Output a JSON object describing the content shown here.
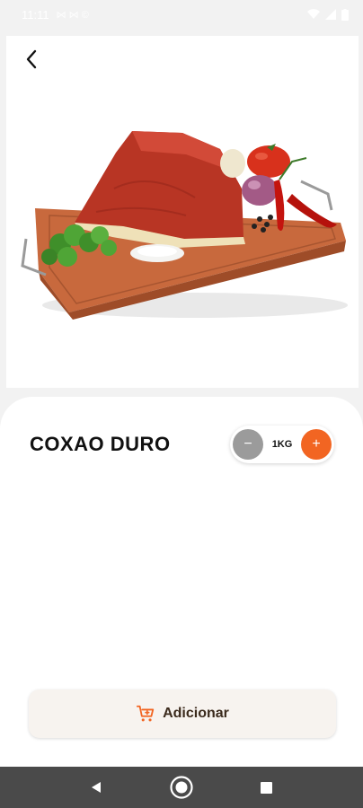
{
  "status_bar": {
    "time": "11:11",
    "notifications": "⋈ ⋈ ©"
  },
  "product": {
    "name": "COXAO DURO",
    "quantity": "1KG"
  },
  "quantity_control": {
    "minus": "−",
    "plus": "+"
  },
  "actions": {
    "add_label": "Adicionar"
  },
  "colors": {
    "accent": "#f26522",
    "minus_button": "#9b9b9b",
    "nav_bar": "#4a4a4a"
  },
  "icons": {
    "back": "chevron-left-icon",
    "cart": "cart-icon",
    "nav_back": "triangle-back-icon",
    "nav_home": "circle-home-icon",
    "nav_recent": "square-recent-icon"
  }
}
